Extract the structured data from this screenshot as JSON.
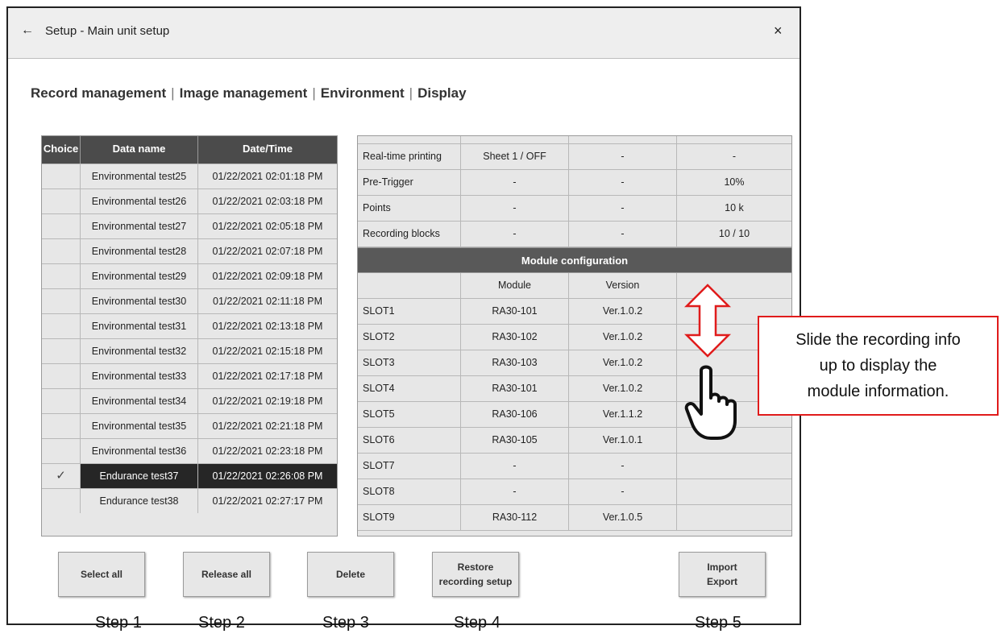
{
  "window": {
    "title": "Setup - Main unit setup",
    "back_icon": "←",
    "close_icon": "×"
  },
  "tabs": [
    "Record management",
    "Image management",
    "Environment",
    "Display"
  ],
  "tab_separator": "|",
  "data_table": {
    "headers": {
      "choice": "Choice",
      "name": "Data name",
      "date": "Date/Time"
    },
    "rows": [
      {
        "choice": "",
        "name": "Environmental test25",
        "date": "01/22/2021 02:01:18 PM"
      },
      {
        "choice": "",
        "name": "Environmental test26",
        "date": "01/22/2021 02:03:18 PM"
      },
      {
        "choice": "",
        "name": "Environmental test27",
        "date": "01/22/2021 02:05:18 PM"
      },
      {
        "choice": "",
        "name": "Environmental test28",
        "date": "01/22/2021 02:07:18 PM"
      },
      {
        "choice": "",
        "name": "Environmental test29",
        "date": "01/22/2021 02:09:18 PM"
      },
      {
        "choice": "",
        "name": "Environmental test30",
        "date": "01/22/2021 02:11:18 PM"
      },
      {
        "choice": "",
        "name": "Environmental test31",
        "date": "01/22/2021 02:13:18 PM"
      },
      {
        "choice": "",
        "name": "Environmental test32",
        "date": "01/22/2021 02:15:18 PM"
      },
      {
        "choice": "",
        "name": "Environmental test33",
        "date": "01/22/2021 02:17:18 PM"
      },
      {
        "choice": "",
        "name": "Environmental test34",
        "date": "01/22/2021 02:19:18 PM"
      },
      {
        "choice": "",
        "name": "Environmental test35",
        "date": "01/22/2021 02:21:18 PM"
      },
      {
        "choice": "",
        "name": "Environmental test36",
        "date": "01/22/2021 02:23:18 PM"
      },
      {
        "choice": "✓",
        "name": "Endurance test37",
        "date": "01/22/2021 02:26:08 PM",
        "selected": true
      },
      {
        "choice": "",
        "name": "Endurance test38",
        "date": "01/22/2021 02:27:17 PM"
      }
    ]
  },
  "info_table": {
    "rows_top": [
      [
        "Real-time printing",
        "Sheet 1 / OFF",
        "-",
        "-"
      ],
      [
        "Pre-Trigger",
        "-",
        "-",
        "10%"
      ],
      [
        "Points",
        "-",
        "-",
        "10 k"
      ],
      [
        "Recording blocks",
        "-",
        "-",
        "10 / 10"
      ]
    ],
    "section_title": "Module configuration",
    "module_header": [
      "",
      "Module",
      "Version",
      ""
    ],
    "slots": [
      [
        "SLOT1",
        "RA30-101",
        "Ver.1.0.2",
        ""
      ],
      [
        "SLOT2",
        "RA30-102",
        "Ver.1.0.2",
        ""
      ],
      [
        "SLOT3",
        "RA30-103",
        "Ver.1.0.2",
        ""
      ],
      [
        "SLOT4",
        "RA30-101",
        "Ver.1.0.2",
        ""
      ],
      [
        "SLOT5",
        "RA30-106",
        "Ver.1.1.2",
        ""
      ],
      [
        "SLOT6",
        "RA30-105",
        "Ver.1.0.1",
        ""
      ],
      [
        "SLOT7",
        "-",
        "-",
        ""
      ],
      [
        "SLOT8",
        "-",
        "-",
        ""
      ],
      [
        "SLOT9",
        "RA30-112",
        "Ver.1.0.5",
        ""
      ]
    ]
  },
  "buttons": {
    "select_all": "Select all",
    "release_all": "Release all",
    "delete": "Delete",
    "restore": "Restore\nrecording setup",
    "import_export": "Import\nExport"
  },
  "steps": [
    "Step 1",
    "Step 2",
    "Step 3",
    "Step 4",
    "Step 5"
  ],
  "annotation": {
    "lines": [
      "Slide the recording info",
      "up to display the",
      "module information."
    ],
    "arrow_color": "#e01b1b",
    "icons": [
      "double-arrow-vertical-icon",
      "pointing-hand-icon"
    ]
  }
}
